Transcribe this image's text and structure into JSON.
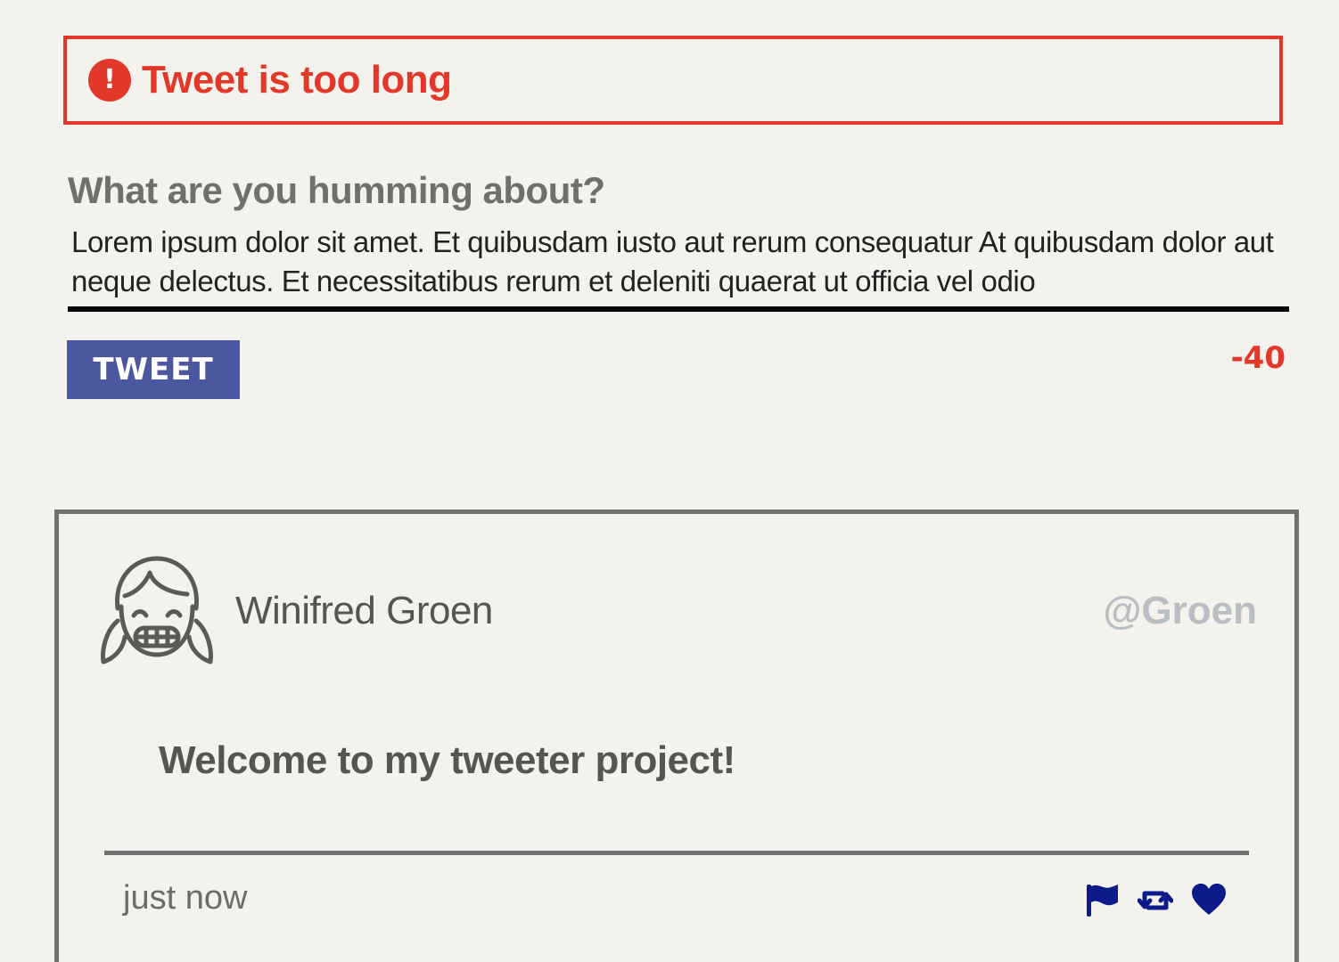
{
  "error": {
    "icon": "exclamation-circle-icon",
    "message": "Tweet is too long",
    "color": "#e2382a"
  },
  "compose": {
    "label": "What are you humming about?",
    "textarea_value": "Lorem ipsum dolor sit amet. Et quibusdam iusto aut rerum consequatur At quibusdam dolor aut neque delectus. Et necessitatibus rerum et deleniti quaerat ut officia vel odio",
    "button_label": "TWEET",
    "button_color": "#4b58a0",
    "counter": "-40",
    "counter_color": "#e2382a"
  },
  "tweet": {
    "avatar_icon": "girl-avatar-icon",
    "name": "Winifred Groen",
    "handle": "@Groen",
    "content": "Welcome to my tweeter project!",
    "timestamp": "just now",
    "actions": [
      {
        "name": "flag-icon"
      },
      {
        "name": "retweet-icon"
      },
      {
        "name": "heart-icon"
      }
    ],
    "action_color": "#0d1a8a"
  }
}
